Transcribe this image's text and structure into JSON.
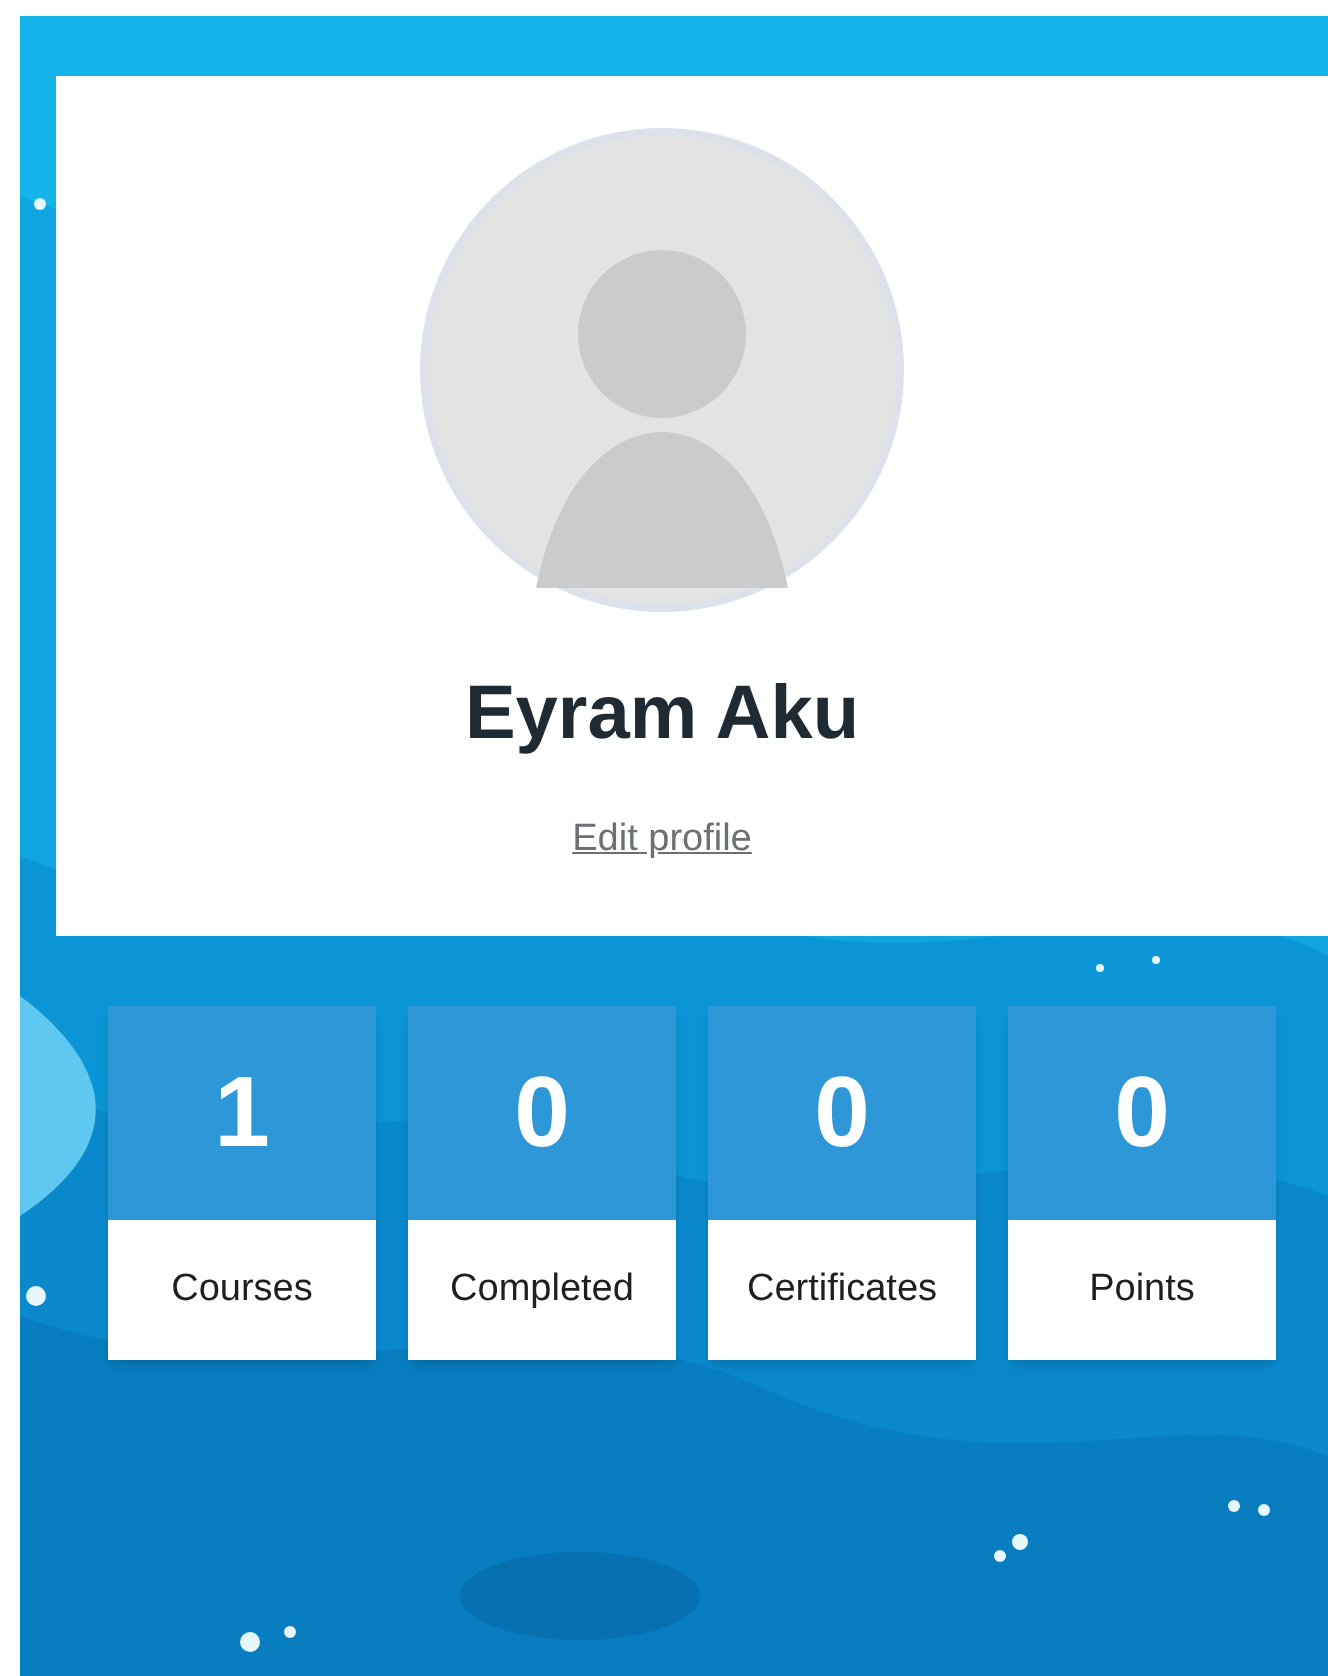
{
  "profile": {
    "name": "Eyram Aku",
    "edit_link": "Edit profile"
  },
  "stats": [
    {
      "value": "1",
      "label": "Courses"
    },
    {
      "value": "0",
      "label": "Completed"
    },
    {
      "value": "0",
      "label": "Certificates"
    },
    {
      "value": "0",
      "label": "Points"
    }
  ]
}
